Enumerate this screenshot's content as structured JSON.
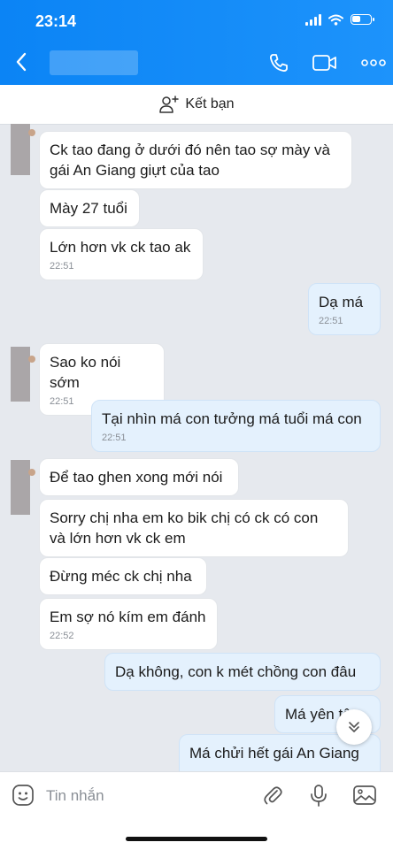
{
  "status_bar": {
    "time": "23:14"
  },
  "header": {
    "contact_name": ""
  },
  "friend_bar": {
    "label": "Kết bạn"
  },
  "messages": [
    {
      "text": "Ck tao đang ở dưới đó nên tao sợ mày và\ngái An Giang giựt của tao",
      "time": ""
    },
    {
      "text": "Mày 27 tuổi",
      "time": ""
    },
    {
      "text": "Lớn hơn vk ck tao ak",
      "time": "22:51"
    },
    {
      "text": "Dạ má",
      "time": "22:51"
    },
    {
      "text": "Sao ko nói sớm",
      "time": "22:51"
    },
    {
      "text": "Tại nhìn má con tưởng má tuổi má con",
      "time": "22:51"
    },
    {
      "text": "Để tao ghen xong mới nói",
      "time": ""
    },
    {
      "text": "Sorry chị nha em ko bik chị có ck có con\nvà lớn hơn vk ck em",
      "time": ""
    },
    {
      "text": "Đừng méc ck chị nha",
      "time": ""
    },
    {
      "text": "Em sợ nó kím em đánh",
      "time": "22:52"
    },
    {
      "text": "Dạ không, con k mét chồng con đâu",
      "time": ""
    },
    {
      "text": "Má yên tâ",
      "time": ""
    },
    {
      "text": "Má chửi hết gái An Giang",
      "time": ""
    }
  ],
  "composer": {
    "placeholder": "Tin nhắn"
  },
  "colors": {
    "header": "#1a8ef8",
    "incoming_bubble": "#ffffff",
    "outgoing_bubble": "#e4f1fd",
    "chat_bg": "#e6e9ee"
  }
}
